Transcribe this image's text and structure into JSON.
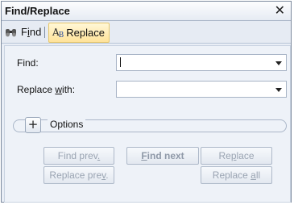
{
  "window": {
    "title": "Find/Replace",
    "close_glyph": "✕"
  },
  "tabs": [
    {
      "label": "Find",
      "underline_char": "i",
      "icon": "binoculars-icon",
      "active": false
    },
    {
      "label": "Replace",
      "underline_char": "",
      "icon": "replace-ab-icon",
      "active": true
    }
  ],
  "form": {
    "find_label": "Find:",
    "find_value": "",
    "replace_label": "Replace with:",
    "replace_value": ""
  },
  "options": {
    "label": "Options",
    "expand_glyph": "+"
  },
  "buttons": {
    "find_prev": "Find prev.",
    "find_next": "Find next",
    "replace": "Replace",
    "replace_prev": "Replace prev.",
    "replace_all": "Replace all"
  }
}
